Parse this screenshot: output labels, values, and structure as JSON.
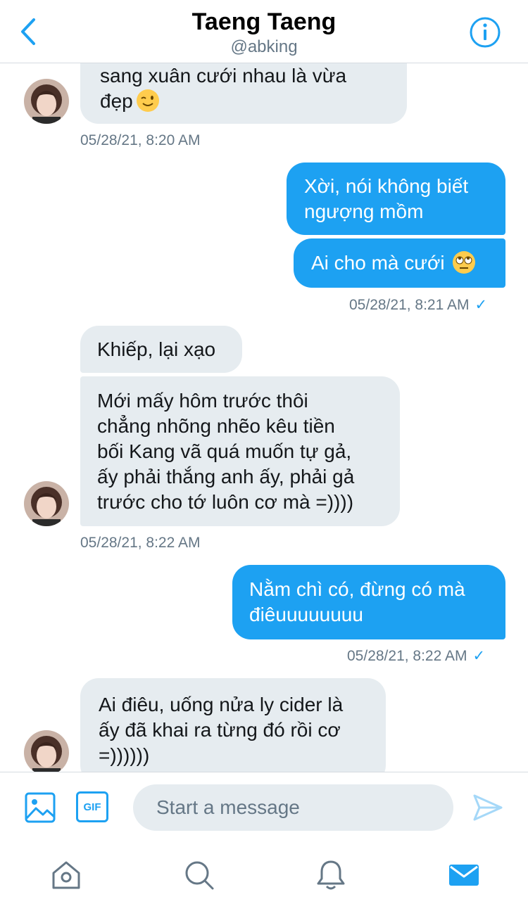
{
  "header": {
    "title": "Taeng Taeng",
    "handle": "@abking"
  },
  "messages": {
    "m1_line1": "sang xuân cưới nhau là vừa",
    "m1_line2": "đẹp",
    "ts1": "05/28/21, 8:20 AM",
    "m2_line1": "Xời, nói không biết",
    "m2_line2": "ngượng mồm",
    "m3_text": "Ai cho mà cưới",
    "ts2": "05/28/21, 8:21 AM",
    "m4_text": "Khiếp, lại xạo",
    "m5_line1": "Mới mấy hôm trước thôi",
    "m5_line2": "chẳng nhõng nhẽo kêu tiền",
    "m5_line3": "bối Kang vã quá muốn tự gả,",
    "m5_line4": "ấy phải thắng anh ấy, phải gả",
    "m5_line5": "trước cho tớ luôn cơ mà =))))",
    "ts3": "05/28/21, 8:22 AM",
    "m6_line1": "Nằm chì có, đừng có mà",
    "m6_line2": "điêuuuuuuuu",
    "ts4": "05/28/21, 8:22 AM",
    "m7_line1": "Ai điêu, uống nửa ly cider là",
    "m7_line2": "ấy đã khai ra từng đó rồi cơ",
    "m7_line3": "=))))))",
    "check_mark": "✓"
  },
  "composer": {
    "gif_label": "GIF",
    "placeholder": "Start a message"
  },
  "icons": {
    "back": "chevron-left-icon",
    "info": "info-icon",
    "image": "image-icon",
    "send": "send-icon",
    "home": "home-icon",
    "search": "search-icon",
    "notifications": "bell-icon",
    "messages": "mail-icon"
  },
  "colors": {
    "accent": "#1da1f2",
    "incoming_bubble": "#e6ecf0",
    "secondary_text": "#657786"
  }
}
